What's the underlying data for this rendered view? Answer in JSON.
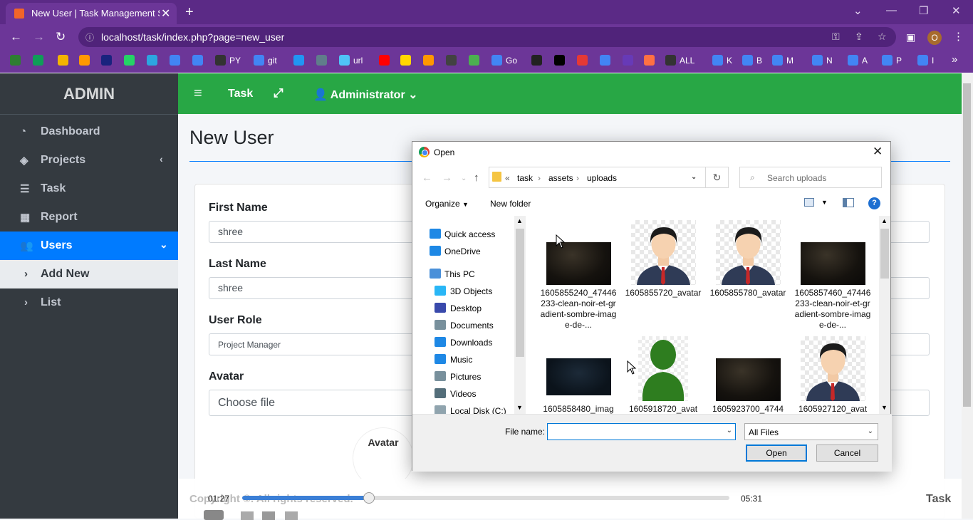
{
  "browser": {
    "tab_title": "New User | Task Management Sy",
    "tab_close": "✕",
    "new_tab": "+",
    "url": "localhost/task/index.php?page=new_user",
    "profile_initial": "O",
    "bookmarks": [
      {
        "label": "",
        "color": "#2e7d32"
      },
      {
        "label": "",
        "color": "#0f9d58"
      },
      {
        "label": "",
        "color": "#f4b400"
      },
      {
        "label": "",
        "color": "#ff9800"
      },
      {
        "label": "",
        "color": "#1a237e"
      },
      {
        "label": "",
        "color": "#25d366"
      },
      {
        "label": "",
        "color": "#2ca5e0"
      },
      {
        "label": "",
        "color": "#4285f4"
      },
      {
        "label": "",
        "color": "#4285f4"
      },
      {
        "label": "PY",
        "color": "#333333"
      },
      {
        "label": "git",
        "color": "#4285f4"
      },
      {
        "label": "",
        "color": "#2196f3"
      },
      {
        "label": "",
        "color": "#607d8b"
      },
      {
        "label": "url",
        "color": "#4fc3f7"
      },
      {
        "label": "",
        "color": "#ff0000"
      },
      {
        "label": "",
        "color": "#ffd600"
      },
      {
        "label": "",
        "color": "#ff9800"
      },
      {
        "label": "",
        "color": "#424242"
      },
      {
        "label": "",
        "color": "#4caf50"
      },
      {
        "label": "Go",
        "color": "#4285f4"
      },
      {
        "label": "",
        "color": "#222222"
      },
      {
        "label": "",
        "color": "#000000"
      },
      {
        "label": "",
        "color": "#e53935"
      },
      {
        "label": "",
        "color": "#4285f4"
      },
      {
        "label": "",
        "color": "#673ab7"
      },
      {
        "label": "",
        "color": "#ff7043"
      },
      {
        "label": "ALL",
        "color": "#333333"
      },
      {
        "label": "K",
        "color": "#4285f4"
      },
      {
        "label": "B",
        "color": "#4285f4"
      },
      {
        "label": "M",
        "color": "#4285f4"
      },
      {
        "label": "N",
        "color": "#4285f4"
      },
      {
        "label": "A",
        "color": "#4285f4"
      },
      {
        "label": "P",
        "color": "#4285f4"
      },
      {
        "label": "I",
        "color": "#4285f4"
      }
    ],
    "bookmarks_more": "»"
  },
  "sidebar": {
    "brand": "ADMIN",
    "items": [
      {
        "label": "Dashboard",
        "icon": "tachometer-icon"
      },
      {
        "label": "Projects",
        "icon": "layers-icon",
        "chevron": "‹"
      },
      {
        "label": "Task",
        "icon": "tasks-icon"
      },
      {
        "label": "Report",
        "icon": "table-icon"
      },
      {
        "label": "Users",
        "icon": "users-icon",
        "chevron": "⌄"
      }
    ],
    "subitems": [
      {
        "label": "Add New"
      },
      {
        "label": "List"
      }
    ]
  },
  "topnav": {
    "menu_icon": "≡",
    "title": "Task",
    "expand_icon": "⤢",
    "user": "Administrator"
  },
  "form": {
    "page_title": "New User",
    "first_name_label": "First Name",
    "first_name_value": "shree",
    "last_name_label": "Last Name",
    "last_name_value": "shree",
    "role_label": "User Role",
    "role_value": "Project Manager",
    "avatar_label": "Avatar",
    "avatar_button": "Choose file",
    "avatar_alt": "Avatar"
  },
  "media": {
    "current_time": "01:27",
    "total_time": "05:31",
    "progress": 0.26,
    "copyright": "Copyright ©. All rights reserved.",
    "brand": "Task"
  },
  "dialog": {
    "title": "Open",
    "path": [
      "task",
      "assets",
      "uploads"
    ],
    "search_placeholder": "Search uploads",
    "organize": "Organize",
    "new_folder": "New folder",
    "help": "?",
    "tree": [
      {
        "label": "Quick access",
        "icon": "#1e88e5",
        "indent": 0
      },
      {
        "label": "OneDrive",
        "icon": "#1e88e5",
        "indent": 0
      },
      {
        "label": "This PC",
        "icon": "#4a90d9",
        "indent": 0
      },
      {
        "label": "3D Objects",
        "icon": "#29b6f6",
        "indent": 1
      },
      {
        "label": "Desktop",
        "icon": "#3949ab",
        "indent": 1
      },
      {
        "label": "Documents",
        "icon": "#78909c",
        "indent": 1
      },
      {
        "label": "Downloads",
        "icon": "#1e88e5",
        "indent": 1
      },
      {
        "label": "Music",
        "icon": "#1e88e5",
        "indent": 1
      },
      {
        "label": "Pictures",
        "icon": "#78909c",
        "indent": 1
      },
      {
        "label": "Videos",
        "icon": "#546e7a",
        "indent": 1
      },
      {
        "label": "Local Disk (C:)",
        "icon": "#90a4ae",
        "indent": 1
      }
    ],
    "files": [
      {
        "name": "1605855240_47446233-clean-noir-et-gradient-sombre-image-de-...",
        "thumb": "dark"
      },
      {
        "name": "1605855720_avatar",
        "thumb": "avatar"
      },
      {
        "name": "1605855780_avatar",
        "thumb": "avatar"
      },
      {
        "name": "1605857460_47446233-clean-noir-et-gradient-sombre-image-de-...",
        "thumb": "dark"
      },
      {
        "name": "1605858480_imag",
        "thumb": "darkblue"
      },
      {
        "name": "1605918720_avat",
        "thumb": "green"
      },
      {
        "name": "1605923700_4744",
        "thumb": "dark"
      },
      {
        "name": "1605927120_avat",
        "thumb": "avatar"
      }
    ],
    "file_name_label": "File name:",
    "file_name_value": "",
    "filter": "All Files",
    "open_button": "Open",
    "cancel_button": "Cancel"
  }
}
